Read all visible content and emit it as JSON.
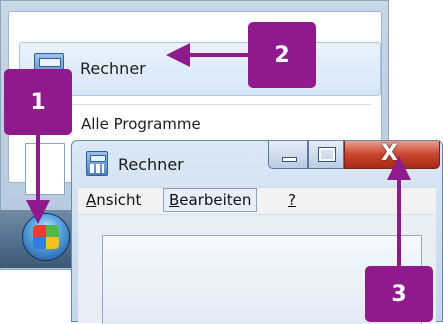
{
  "start_menu": {
    "item_rechner": "Rechner",
    "item_alle_programme": "Alle Programme"
  },
  "window": {
    "title": "Rechner",
    "menu": {
      "ansicht_first": "A",
      "ansicht_rest": "nsicht",
      "bearbeiten_first": "B",
      "bearbeiten_rest": "earbeiten",
      "help": "?"
    },
    "close_glyph": "X"
  },
  "callouts": {
    "one": "1",
    "two": "2",
    "three": "3"
  },
  "colors": {
    "callout": "#8e1a8c",
    "close_button": "#c9452e"
  },
  "icons": [
    "calculator-icon",
    "start-orb-icon",
    "minimize-icon",
    "maximize-icon",
    "close-icon"
  ]
}
